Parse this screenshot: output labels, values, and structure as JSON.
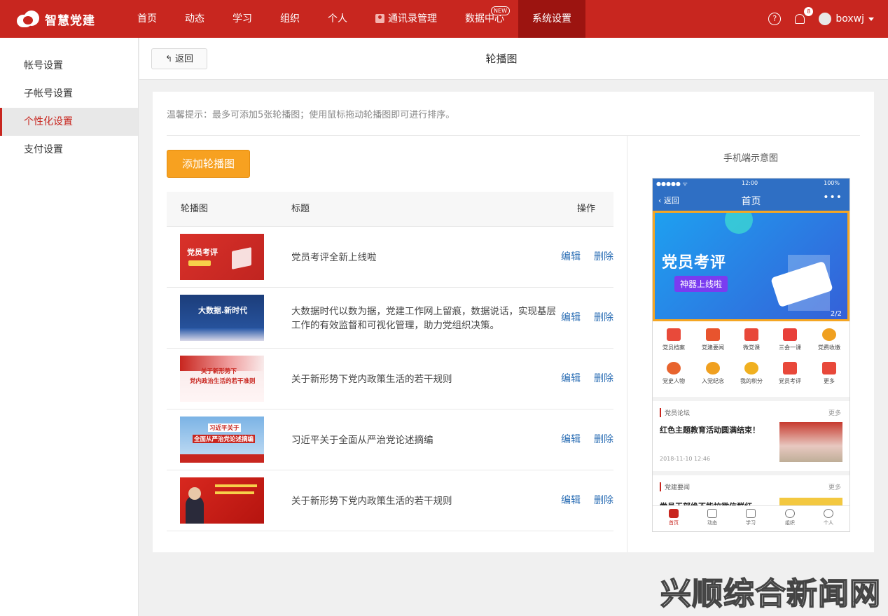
{
  "brand": {
    "name": "智慧党建"
  },
  "nav": {
    "items": [
      {
        "label": "首页"
      },
      {
        "label": "动态"
      },
      {
        "label": "学习"
      },
      {
        "label": "组织"
      },
      {
        "label": "个人"
      },
      {
        "label": "通讯录管理"
      },
      {
        "label": "数据中心",
        "badge": "NEW"
      },
      {
        "label": "系统设置",
        "active": true
      }
    ],
    "notifications_count": "8",
    "username": "boxwj"
  },
  "sidebar": {
    "items": [
      {
        "label": "帐号设置"
      },
      {
        "label": "子帐号设置"
      },
      {
        "label": "个性化设置",
        "active": true
      },
      {
        "label": "支付设置"
      }
    ]
  },
  "subheader": {
    "back_label": "返回",
    "title": "轮播图"
  },
  "main": {
    "tip": "温馨提示：最多可添加5张轮播图；使用鼠标拖动轮播图即可进行排序。",
    "add_button": "添加轮播图",
    "columns": {
      "image": "轮播图",
      "title": "标题",
      "actions": "操作"
    },
    "rows": [
      {
        "title": "党员考评全新上线啦",
        "edit": "编辑",
        "delete": "删除",
        "thumb_text": "党员考评"
      },
      {
        "title": "大数据时代以数为据，党建工作网上留痕，数据说话，实现基层工作的有效监督和可视化管理，助力党组织决策。",
        "edit": "编辑",
        "delete": "删除",
        "thumb_text": "大数据.新时代"
      },
      {
        "title": "关于新形势下党内政策生活的若干规则",
        "edit": "编辑",
        "delete": "删除",
        "thumb_text": "关于新形势下",
        "thumb_text2": "党内政治生活的若干准则"
      },
      {
        "title": "习近平关于全面从严治党论述摘编",
        "edit": "编辑",
        "delete": "删除",
        "thumb_text": "习近平关于",
        "thumb_text2": "全面从严治党论述摘编"
      },
      {
        "title": "关于新形势下党内政策生活的若干规则",
        "edit": "编辑",
        "delete": "删除"
      }
    ]
  },
  "phone": {
    "label": "手机端示意图",
    "time": "12:00",
    "battery": "100%",
    "back": "返回",
    "title": "首页",
    "banner_title": "党员考评",
    "banner_pill": "神器上线啦",
    "pager": "2/2",
    "grid": [
      {
        "label": "党员档案",
        "color": "#e84a3a"
      },
      {
        "label": "党建要闻",
        "color": "#e8542e"
      },
      {
        "label": "微党课",
        "color": "#e8483a"
      },
      {
        "label": "三会一课",
        "color": "#e8403a"
      },
      {
        "label": "党费收缴",
        "color": "#f0a020"
      },
      {
        "label": "党史人物",
        "color": "#e8642e"
      },
      {
        "label": "入党纪念",
        "color": "#f0a020"
      },
      {
        "label": "我的积分",
        "color": "#f0b020"
      },
      {
        "label": "党员考评",
        "color": "#e8483a"
      },
      {
        "label": "更多",
        "color": "#e8483a"
      }
    ],
    "forum": {
      "section": "党员论坛",
      "more": "更多",
      "headline": "红色主题教育活动圆满结束！",
      "time": "2018-11-10 12:46"
    },
    "news": {
      "section": "党建要闻",
      "more": "更多",
      "headline": "党员干部绝不能拉微信群红"
    },
    "tabs": [
      {
        "label": "首页",
        "active": true
      },
      {
        "label": "动态"
      },
      {
        "label": "学习"
      },
      {
        "label": "组织"
      },
      {
        "label": "个人"
      }
    ]
  },
  "watermark": "兴顺综合新闻网",
  "colors": {
    "brand_red": "#c8261f",
    "accent_orange": "#f7a120",
    "link_blue": "#2d6fb5"
  }
}
